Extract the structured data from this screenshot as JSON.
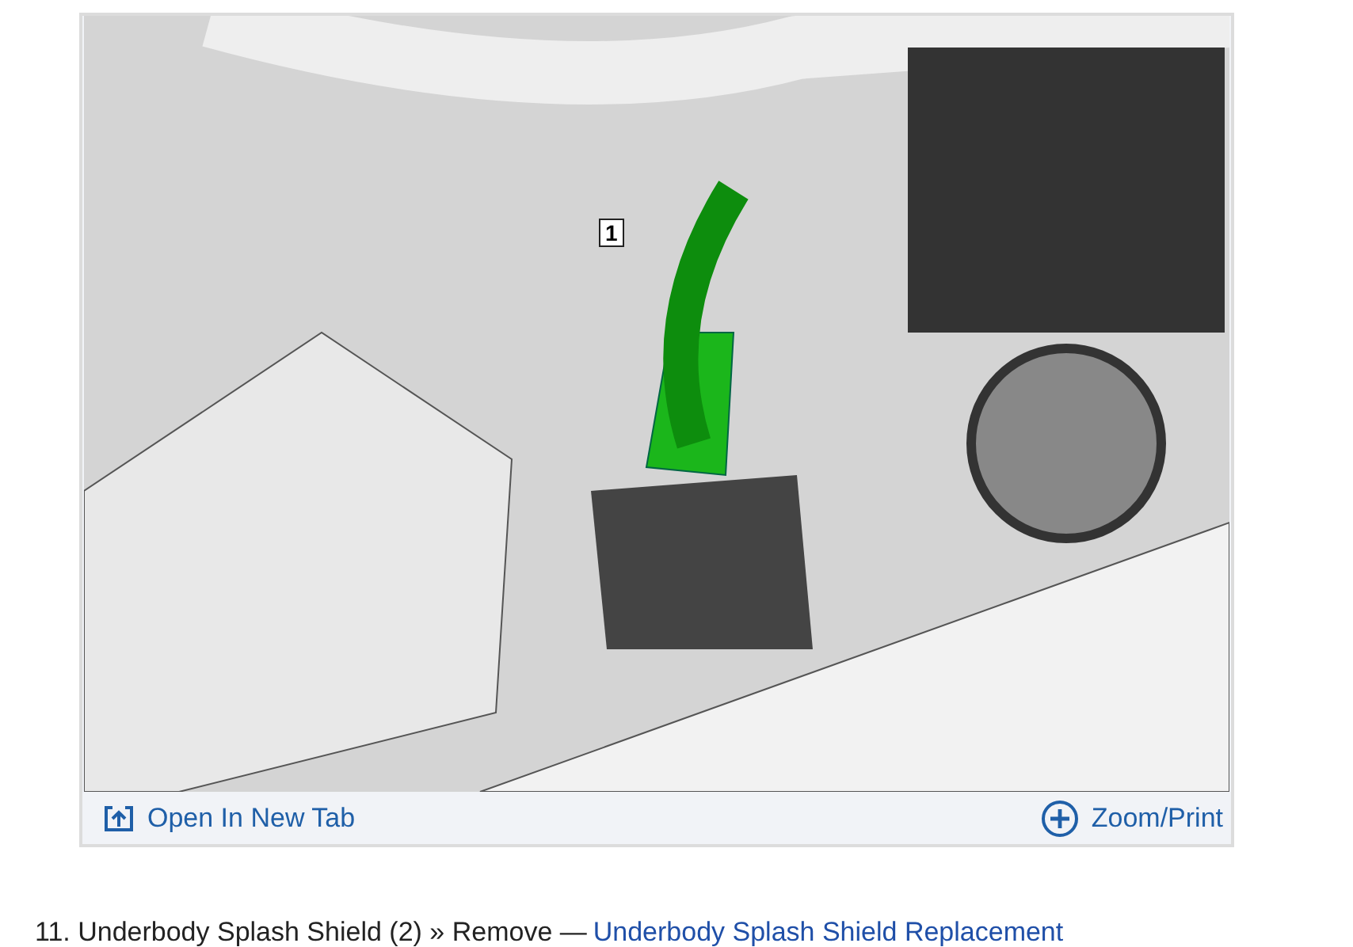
{
  "figure": {
    "callout": "1",
    "open_link": "Open In New Tab",
    "zoom_link": "Zoom/Print"
  },
  "step": {
    "number": "11.",
    "text": "Underbody Splash Shield (2) » Remove —",
    "link": "Underbody Splash Shield Replacement"
  }
}
